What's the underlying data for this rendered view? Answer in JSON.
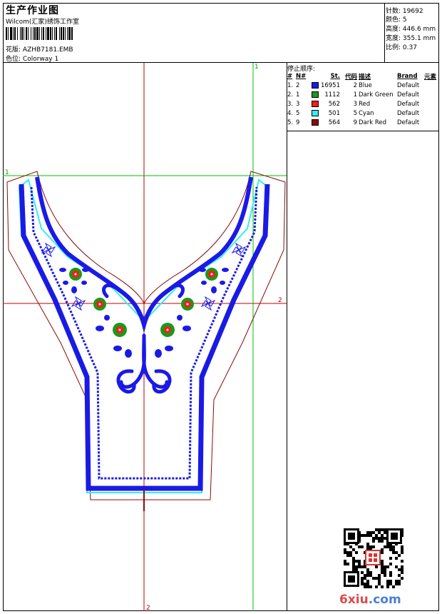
{
  "header": {
    "title": "生产作业图",
    "company": "Wilcom(汇家)绣饰工作室",
    "design_label": "花版:",
    "design_value": "AZHB7181.EMB",
    "colorway_label": "色位:",
    "colorway_value": "Colorway 1"
  },
  "stats": [
    {
      "label": "针数:",
      "value": "19692"
    },
    {
      "label": "颜色:",
      "value": "5"
    },
    {
      "label": "高度:",
      "value": "446.6 mm"
    },
    {
      "label": "宽度:",
      "value": "355.1 mm"
    },
    {
      "label": "比例:",
      "value": "0.37"
    }
  ],
  "stop_sequence": {
    "title": "停止顺序:",
    "columns": {
      "num": "#",
      "n": "N#",
      "st": "St.",
      "code": "代码",
      "desc": "描述",
      "brand": "Brand",
      "element": "元素"
    },
    "rows": [
      {
        "num": "1.",
        "n": "2",
        "color": "#1a1ae6",
        "st": "16951",
        "code": "2",
        "desc": "Blue",
        "brand": "Default"
      },
      {
        "num": "2.",
        "n": "1",
        "color": "#1a9a1a",
        "st": "1112",
        "code": "1",
        "desc": "Dark Green",
        "brand": "Default"
      },
      {
        "num": "3.",
        "n": "3",
        "color": "#ff1a1a",
        "st": "562",
        "code": "3",
        "desc": "Red",
        "brand": "Default"
      },
      {
        "num": "4.",
        "n": "5",
        "color": "#33eeee",
        "st": "501",
        "code": "5",
        "desc": "Cyan",
        "brand": "Default"
      },
      {
        "num": "5.",
        "n": "9",
        "color": "#8b0a0a",
        "st": "564",
        "code": "9",
        "desc": "Dark Red",
        "brand": "Default"
      }
    ]
  },
  "guides": {
    "v1": "1",
    "h1": "1",
    "h2": "2",
    "v2": "2"
  },
  "colors": {
    "blue": "#1a1ae6",
    "green": "#1a9a1a",
    "red": "#ff1a1a",
    "cyan": "#33eeee",
    "darkred": "#8b0a0a",
    "guide_red": "#c00000",
    "guide_green": "#00c000"
  },
  "watermark": {
    "text_a": "6xiu",
    "text_b": ".com"
  },
  "icons": {
    "qr": "qr-code-icon",
    "seal": "red-seal-icon"
  }
}
